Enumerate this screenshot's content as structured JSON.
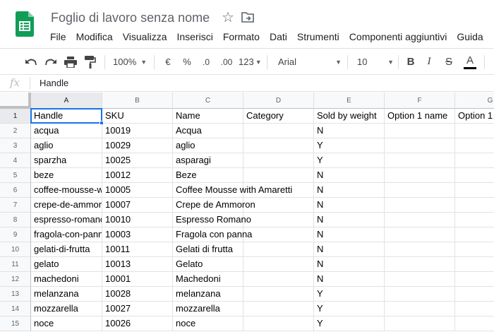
{
  "document": {
    "title": "Foglio di lavoro senza nome"
  },
  "menu": [
    "File",
    "Modifica",
    "Visualizza",
    "Inserisci",
    "Formato",
    "Dati",
    "Strumenti",
    "Componenti aggiuntivi",
    "Guida"
  ],
  "toolbar": {
    "zoom": "100%",
    "currency": "€",
    "percent": "%",
    "decrease_decimal": ".0",
    "increase_decimal": ".00",
    "more_formats": "123",
    "font": "Arial",
    "font_size": "10",
    "bold": "B",
    "italic": "I",
    "strike": "S",
    "text_color_letter": "A",
    "text_color": "#000000"
  },
  "formula_bar": {
    "fx": "fx",
    "value": "Handle"
  },
  "grid": {
    "columns": [
      "A",
      "B",
      "C",
      "D",
      "E",
      "F",
      "G"
    ],
    "rows": [
      "1",
      "2",
      "3",
      "4",
      "5",
      "6",
      "7",
      "8",
      "9",
      "10",
      "11",
      "12",
      "13",
      "14",
      "15"
    ],
    "selected_cell": "A1",
    "data": [
      [
        "Handle",
        "SKU",
        "Name",
        "Category",
        "Sold by weight",
        "Option 1 name",
        "Option 1"
      ],
      [
        "acqua",
        "10019",
        "Acqua",
        "",
        "N",
        "",
        ""
      ],
      [
        "aglio",
        "10029",
        "aglio",
        "",
        "Y",
        "",
        ""
      ],
      [
        "sparzha",
        "10025",
        "asparagi",
        "",
        "Y",
        "",
        ""
      ],
      [
        "beze",
        "10012",
        "Beze",
        "",
        "N",
        "",
        ""
      ],
      [
        "coffee-mousse-w",
        "10005",
        "Coffee Mousse with Amaretti",
        "",
        "N",
        "",
        ""
      ],
      [
        "crepe-de-ammor",
        "10007",
        "Crepe de Ammoron",
        "",
        "N",
        "",
        ""
      ],
      [
        "espresso-romano",
        "10010",
        "Espresso Romano",
        "",
        "N",
        "",
        ""
      ],
      [
        "fragola-con-pann",
        "10003",
        "Fragola con panna",
        "",
        "N",
        "",
        ""
      ],
      [
        "gelati-di-frutta",
        "10011",
        "Gelati di frutta",
        "",
        "N",
        "",
        ""
      ],
      [
        "gelato",
        "10013",
        "Gelato",
        "",
        "N",
        "",
        ""
      ],
      [
        "machedoni",
        "10001",
        "Machedoni",
        "",
        "N",
        "",
        ""
      ],
      [
        "melanzana",
        "10028",
        "melanzana",
        "",
        "Y",
        "",
        ""
      ],
      [
        "mozzarella",
        "10027",
        "mozzarella",
        "",
        "Y",
        "",
        ""
      ],
      [
        "noce",
        "10026",
        "noce",
        "",
        "Y",
        "",
        ""
      ]
    ]
  },
  "colors": {
    "sheets_green": "#0f9d58",
    "selection": "#1a73e8"
  }
}
